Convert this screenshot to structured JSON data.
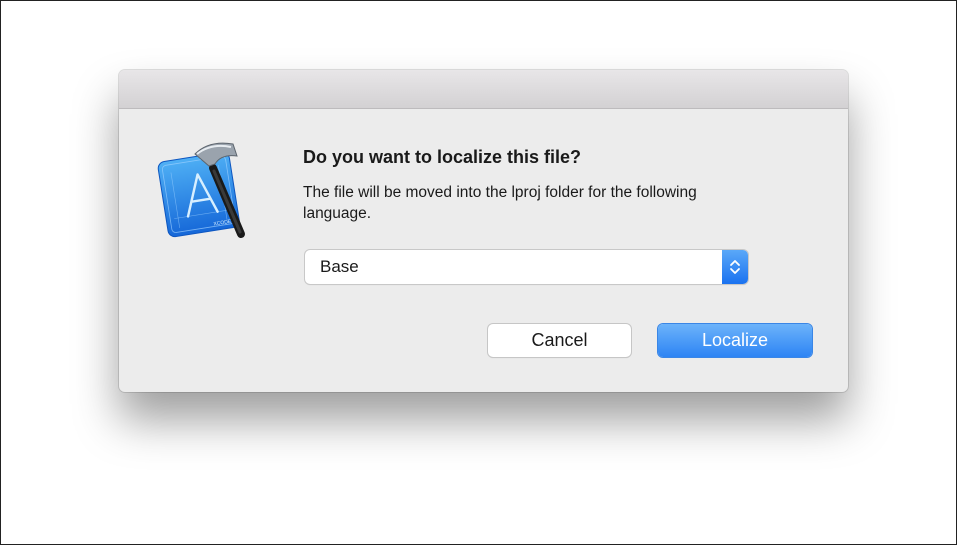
{
  "dialog": {
    "title": "Do you want to localize this file?",
    "message": "The file will be moved into the lproj folder for the following language.",
    "app_icon": "xcode-icon",
    "language_select": {
      "selected": "Base"
    },
    "buttons": {
      "cancel_label": "Cancel",
      "localize_label": "Localize"
    },
    "colors": {
      "accent": "#2d84f4",
      "background": "#ececec"
    }
  }
}
